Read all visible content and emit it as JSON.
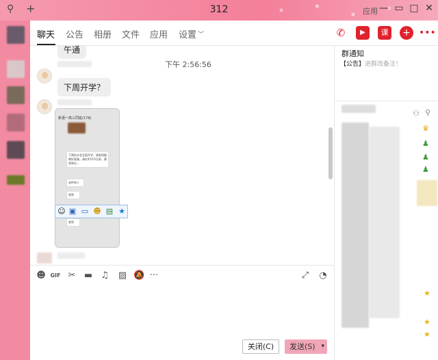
{
  "window": {
    "title": "312",
    "search_icon": "⚲",
    "add_icon": "+",
    "skin_label": "应用"
  },
  "tabs": [
    {
      "label": "聊天",
      "active": true
    },
    {
      "label": "公告"
    },
    {
      "label": "相册"
    },
    {
      "label": "文件"
    },
    {
      "label": "应用"
    },
    {
      "label": "设置"
    }
  ],
  "actions": {
    "call_icon": "phone-icon",
    "video_icon": "video-icon",
    "course_label": "课",
    "invite_icon": "add-member-icon",
    "more_icon": "more-icon"
  },
  "chat": {
    "partial_message": "午通",
    "timestamp": "下午 2:56:56",
    "message": "下周开学？",
    "screenshot": {
      "header": "新语一高三同班(178)",
      "msg1": "下周估计会全面开学，请各班级做好准备，请在4月10日前，通知到位...",
      "msg2": "@所有人",
      "msg3": "收到",
      "msg4": "收到"
    }
  },
  "toolbar": {
    "items": [
      "emoji-icon",
      "gif-icon",
      "scissors-icon",
      "folder-icon",
      "music-icon",
      "image-icon",
      "mute-icon",
      "more-icon"
    ],
    "gif_label": "GIF",
    "more_label": "···"
  },
  "buttons": {
    "close": "关闭(C)",
    "send": "发送(S)",
    "send_dropdown": "▾"
  },
  "right_panel": {
    "title": "群通知",
    "announcement_tag": "【公告】",
    "announcement_text": "进群改备注！"
  },
  "colors": {
    "accent": "#f47f99",
    "action_red": "#e0222d",
    "send_button": "#f0a6b7"
  }
}
